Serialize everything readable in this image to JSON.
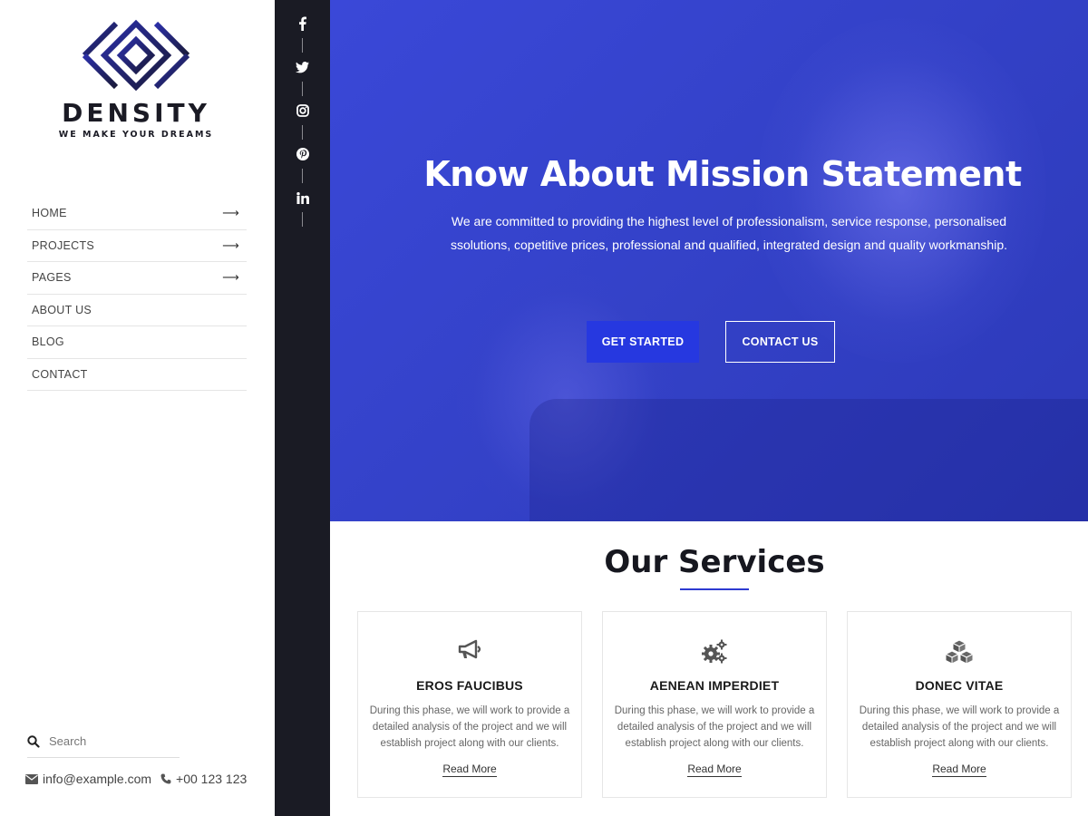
{
  "brand": {
    "name": "DENSITY",
    "tagline": "WE MAKE YOUR DREAMS",
    "logo_colors": [
      "#2b2fa8",
      "#1a1a3a"
    ]
  },
  "nav": {
    "items": [
      {
        "label": "HOME",
        "has_arrow": true
      },
      {
        "label": "PROJECTS",
        "has_arrow": true
      },
      {
        "label": "PAGES",
        "has_arrow": true
      },
      {
        "label": "ABOUT US",
        "has_arrow": false
      },
      {
        "label": "BLOG",
        "has_arrow": false
      },
      {
        "label": "CONTACT",
        "has_arrow": false
      }
    ],
    "arrow_glyph": "⟶"
  },
  "search": {
    "placeholder": "Search",
    "icon": "search-icon"
  },
  "contact": {
    "email": "info@example.com",
    "phone": "+00 123 123",
    "email_icon": "envelope-icon",
    "phone_icon": "phone-icon"
  },
  "social": {
    "icons": [
      "facebook-icon",
      "twitter-icon",
      "instagram-icon",
      "pinterest-icon",
      "linkedin-icon"
    ],
    "bar_color": "#1a1b24"
  },
  "hero": {
    "title": "Know About Mission Statement",
    "text": "We are committed to providing the highest level of professionalism, service response, personalised ssolutions, copetitive prices, professional and qualified, integrated design and quality workmanship.",
    "primary_button": "GET STARTED",
    "secondary_button": "CONTACT US",
    "overlay_color": "#3442c9",
    "button_color": "#2638e0"
  },
  "services": {
    "title": "Our Services",
    "accent_color": "#2e3bd1",
    "cards": [
      {
        "title": "EROS FAUCIBUS",
        "icon": "megaphone-icon",
        "text": "During this phase, we will work to provide a detailed analysis of the project and we will establish project along with our clients.",
        "link": "Read More"
      },
      {
        "title": "AENEAN IMPERDIET",
        "icon": "gears-icon",
        "text": "During this phase, we will work to provide a detailed analysis of the project and we will establish project along with our clients.",
        "link": "Read More"
      },
      {
        "title": "DONEC VITAE",
        "icon": "cubes-icon",
        "text": "During this phase, we will work to provide a detailed analysis of the project and we will establish project along with our clients.",
        "link": "Read More"
      }
    ]
  }
}
